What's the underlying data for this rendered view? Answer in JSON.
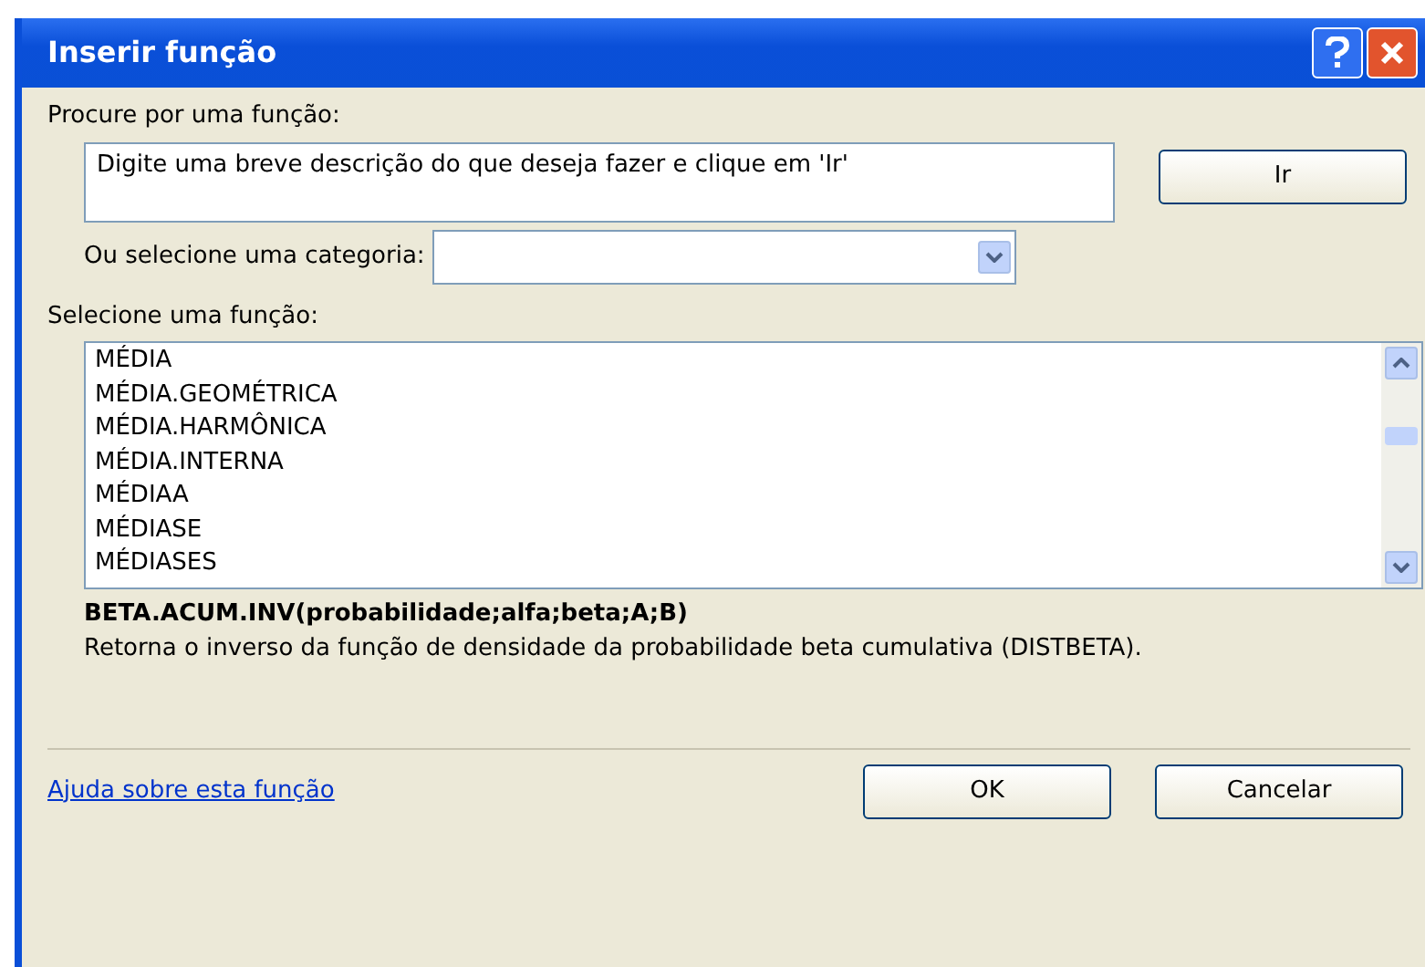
{
  "window": {
    "title": "Inserir função"
  },
  "search": {
    "label": "Procure por uma função:",
    "value": "Digite uma breve descrição do que deseja fazer e clique em 'Ir'",
    "go_button": {
      "label": "Ir"
    }
  },
  "category": {
    "label": "Ou selecione uma categoria:"
  },
  "functions": {
    "label": "Selecione uma função:",
    "items": [
      {
        "name": "MÉDIA",
        "selected": false
      },
      {
        "name": "MÉDIA.GEOMÉTRICA",
        "selected": false
      },
      {
        "name": "MÉDIA.HARMÔNICA",
        "selected": false
      },
      {
        "name": "MÉDIA.INTERNA",
        "selected": false
      },
      {
        "name": "MÉDIAA",
        "selected": false
      },
      {
        "name": "MÉDIASE",
        "selected": false
      },
      {
        "name": "MÉDIASES",
        "selected": false
      }
    ]
  },
  "signature": "BETA.ACUM.INV(probabilidade;alfa;beta;A;B)",
  "description": "Retorna o inverso da função de densidade da probabilidade beta cumulativa (DISTBETA).",
  "help_link": "Ajuda sobre esta função",
  "buttons": [
    "OK",
    "Cancelar"
  ]
}
